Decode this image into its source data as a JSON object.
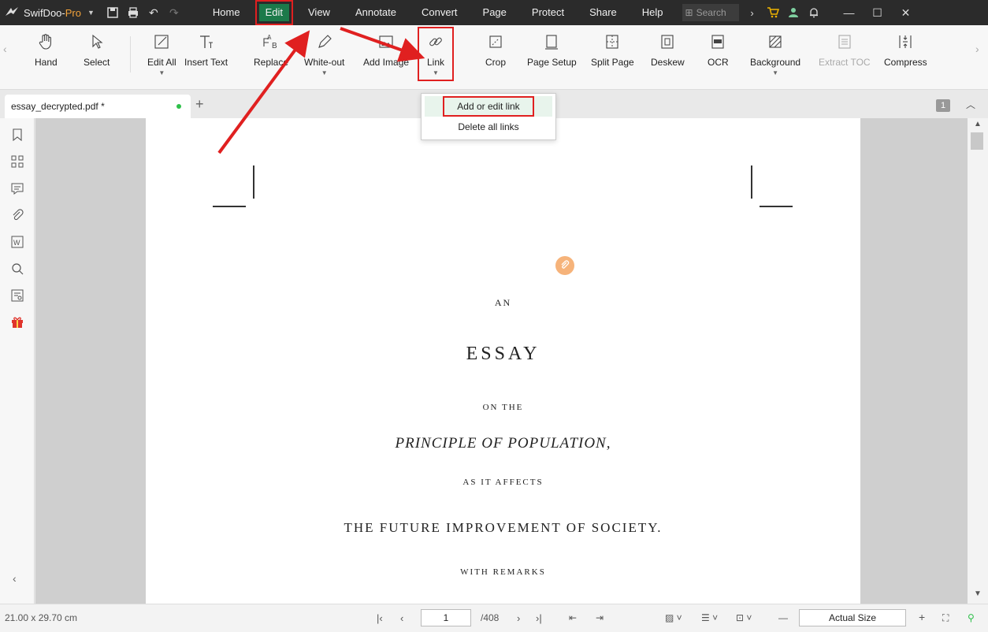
{
  "app": {
    "brand": "SwifDoo-",
    "brand_suffix": "Pro",
    "menus": [
      "Home",
      "Edit",
      "View",
      "Annotate",
      "Convert",
      "Page",
      "Protect",
      "Share",
      "Help"
    ],
    "active_menu": "Edit",
    "search_placeholder": "Search"
  },
  "ribbon": {
    "hand": "Hand",
    "select": "Select",
    "edit_all": "Edit All",
    "insert_text": "Insert Text",
    "replace": "Replace",
    "white_out": "White-out",
    "add_image": "Add Image",
    "link": "Link",
    "crop": "Crop",
    "page_setup": "Page Setup",
    "split_page": "Split Page",
    "deskew": "Deskew",
    "ocr": "OCR",
    "background": "Background",
    "extract_toc": "Extract TOC",
    "compress": "Compress"
  },
  "dropdown": {
    "add_edit_link": "Add or edit link",
    "delete_all_links": "Delete all links"
  },
  "tab": {
    "filename": "essay_decrypted.pdf *",
    "page_badge": "1"
  },
  "document": {
    "line1": "AN",
    "line2": "ESSAY",
    "line3": "ON THE",
    "line4": "PRINCIPLE OF POPULATION,",
    "line5": "AS IT AFFECTS",
    "line6": "THE FUTURE IMPROVEMENT OF SOCIETY.",
    "line7": "WITH REMARKS"
  },
  "status": {
    "page_size": "21.00 x 29.70 cm",
    "current_page": "1",
    "total_pages": "/408",
    "zoom": "Actual Size"
  },
  "colors": {
    "titlebar": "#2b2b2b",
    "active_menu": "#1c7a4a",
    "highlight": "#e02020",
    "pro": "#f2a23a"
  }
}
